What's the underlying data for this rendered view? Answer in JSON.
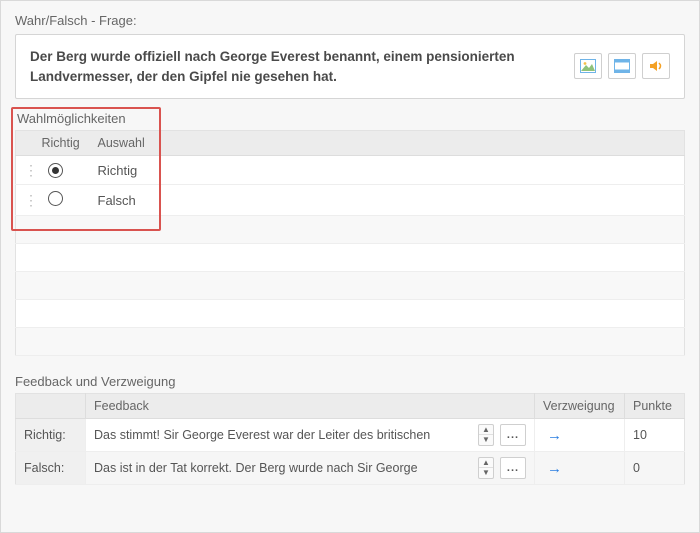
{
  "question": {
    "section_label": "Wahr/Falsch - Frage:",
    "text": "Der Berg wurde offiziell nach George Everest benannt, einem pensionierten Landvermesser, der den Gipfel nie gesehen hat."
  },
  "choices": {
    "section_label": "Wahlmöglichkeiten",
    "headers": {
      "correct": "Richtig",
      "choice": "Auswahl"
    },
    "rows": [
      {
        "label": "Richtig",
        "correct": true
      },
      {
        "label": "Falsch",
        "correct": false
      }
    ]
  },
  "feedback": {
    "section_label": "Feedback und Verzweigung",
    "headers": {
      "feedback": "Feedback",
      "branching": "Verzweigung",
      "points": "Punkte"
    },
    "rows": [
      {
        "label": "Richtig:",
        "text": "Das stimmt! Sir George Everest war der Leiter des britischen",
        "points": "10"
      },
      {
        "label": "Falsch:",
        "text": "Das ist in der Tat korrekt. Der Berg wurde nach Sir George",
        "points": "0"
      }
    ]
  },
  "icons": {
    "ellipsis": "..."
  }
}
